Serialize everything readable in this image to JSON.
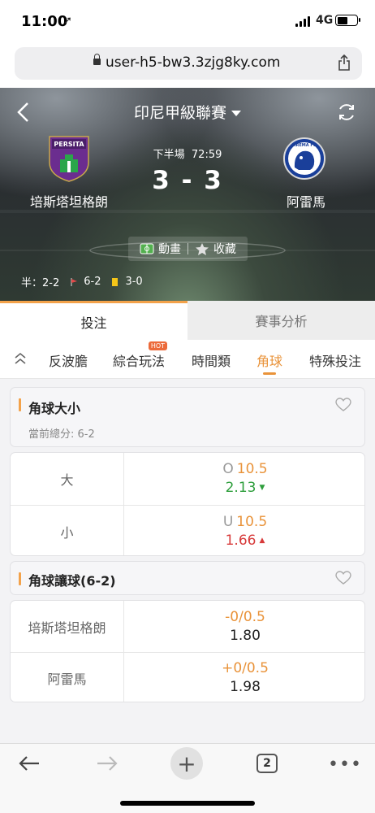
{
  "status": {
    "time": "11:00",
    "network": "4G"
  },
  "browser": {
    "url": "user-h5-bw3.3zjg8ky.com"
  },
  "match": {
    "league": "印尼甲級聯賽",
    "home_team": "培斯塔坦格朗",
    "away_team": "阿雷馬",
    "home_crest_text": "PERSITA",
    "away_crest_text": "AREMA FC",
    "period": "下半場",
    "clock": "72:59",
    "home_score": "3",
    "away_score": "3",
    "score_sep": "-",
    "animation_label": "動畫",
    "favorite_label": "收藏",
    "half_label": "半：2-2",
    "corners": "6-2",
    "yellow_cards": "3-0"
  },
  "tabs": {
    "bet": "投注",
    "analysis": "賽事分析"
  },
  "subtabs": {
    "items": [
      "反波膽",
      "綜合玩法",
      "時間類",
      "角球",
      "特殊投注"
    ],
    "hot_badge": "HOT",
    "active": "角球"
  },
  "markets": {
    "corner_ou": {
      "title": "角球大小",
      "current": "當前總分: 6-2",
      "rows": [
        {
          "label": "大",
          "prefix": "O",
          "line": "10.5",
          "odds": "2.13",
          "trend": "down"
        },
        {
          "label": "小",
          "prefix": "U",
          "line": "10.5",
          "odds": "1.66",
          "trend": "up"
        }
      ]
    },
    "corner_handicap": {
      "title": "角球讓球(6-2)",
      "rows": [
        {
          "label": "培斯塔坦格朗",
          "line": "-0/0.5",
          "odds": "1.80"
        },
        {
          "label": "阿雷馬",
          "line": "+0/0.5",
          "odds": "1.98"
        }
      ]
    }
  },
  "toolbar": {
    "tabs_count": "2",
    "plus": "+",
    "more": "•••"
  },
  "colors": {
    "accent": "#e9933a",
    "down": "#2e9e3c",
    "up": "#d73a3a"
  },
  "icons": [
    "location-arrow-icon",
    "signal-icon",
    "battery-icon",
    "lock-icon",
    "share-icon",
    "back-chevron-icon",
    "caret-down-icon",
    "refresh-icon",
    "pitch-icon",
    "star-icon",
    "corner-flag-icon",
    "yellow-card-icon",
    "collapse-icon",
    "heart-icon",
    "arrow-left-icon",
    "arrow-right-icon",
    "plus-icon",
    "tabs-icon",
    "more-icon"
  ]
}
